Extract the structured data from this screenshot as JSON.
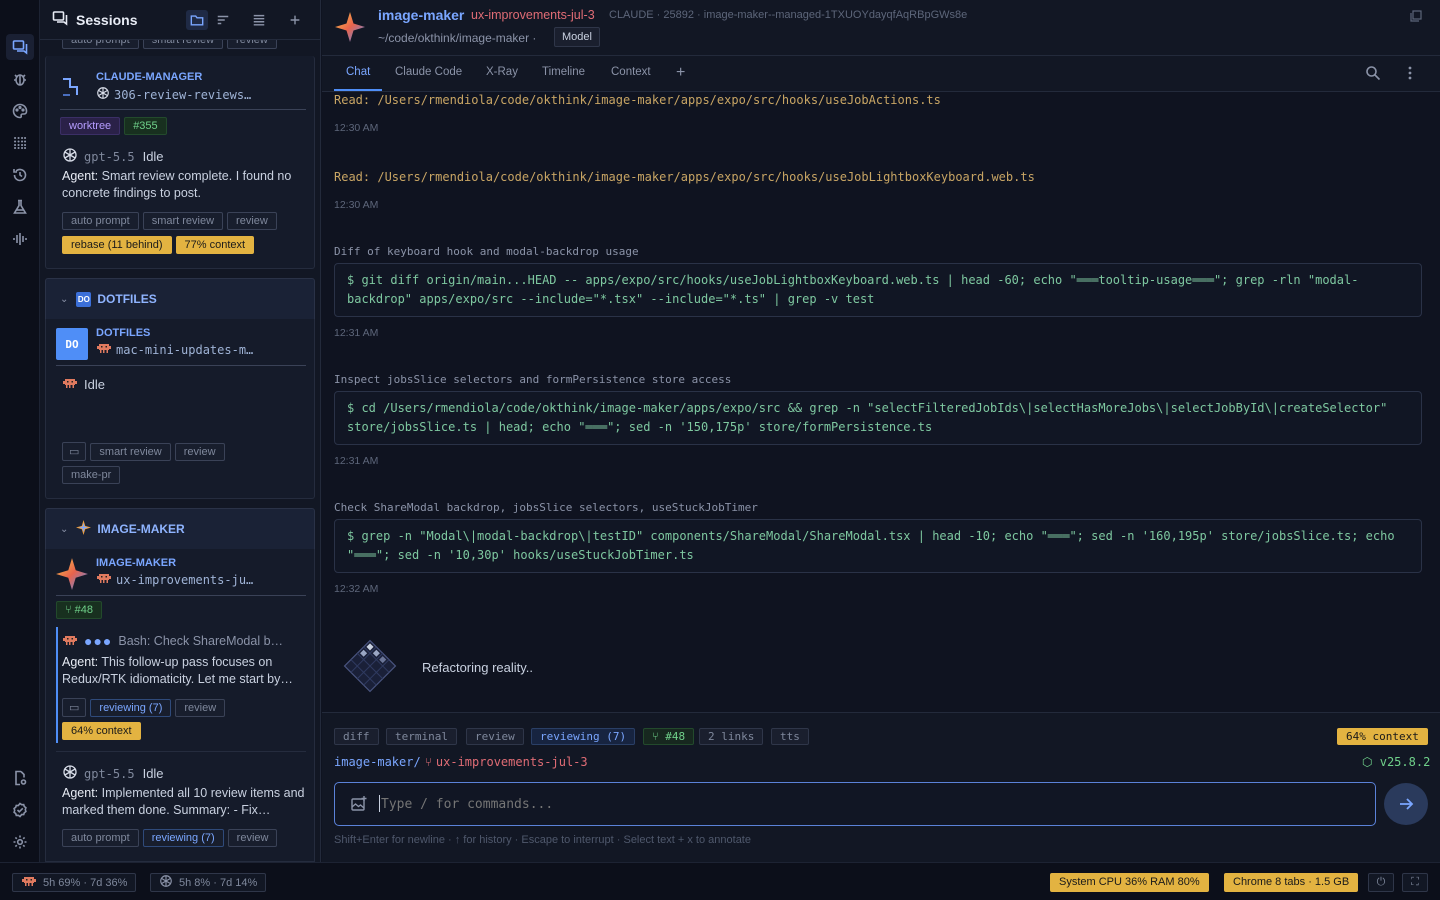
{
  "sessions_header": {
    "title": "Sessions"
  },
  "cards": {
    "top_partial_tags": [
      "auto prompt",
      "smart review",
      "review"
    ],
    "claude_manager": {
      "repo": "CLAUDE-MANAGER",
      "branch": "306-review-reviews…",
      "tags": [
        "worktree",
        "#355"
      ],
      "model": "gpt-5.5",
      "status": "Idle",
      "agent_prefix": "Agent:",
      "agent_text": "Smart review complete. I found no concrete findings to post.",
      "chips": [
        "auto prompt",
        "smart review",
        "review"
      ],
      "warn": [
        "rebase (11 behind)",
        "77% context"
      ]
    },
    "dotfiles_group": {
      "name": "DOTFILES",
      "badge": "DO"
    },
    "dotfiles": {
      "repo": "DOTFILES",
      "avatar": "DO",
      "branch": "mac-mini-updates-m…",
      "status": "Idle",
      "chips": [
        "smart review",
        "review",
        "make-pr"
      ]
    },
    "imagemaker_group": {
      "name": "IMAGE-MAKER"
    },
    "imagemaker": {
      "repo": "IMAGE-MAKER",
      "branch": "ux-improvements-ju…",
      "pr": "#48",
      "activity": "Bash: Check ShareModal b…",
      "agent_prefix": "Agent:",
      "agent_text": "This follow-up pass focuses on Redux/RTK idiomaticity. Let me start by…",
      "chips": [
        "reviewing (7)",
        "review"
      ],
      "warn": "64% context",
      "sub_model": "gpt-5.5",
      "sub_status": "Idle",
      "sub_agent_prefix": "Agent:",
      "sub_agent_text": "Implemented all 10 review items and marked them done. Summary: - Fix…",
      "sub_chips": [
        "auto prompt",
        "reviewing (7)",
        "review"
      ]
    }
  },
  "top": {
    "project": "image-maker",
    "branch": "ux-improvements-jul-3",
    "meta": "CLAUDE · 25892 · image-maker--managed-1TXUOYdayqfAqRBpGWs8e",
    "path": "~/code/okthink/image-maker ·",
    "model_btn": "Model"
  },
  "tabs": [
    "Chat",
    "Claude Code",
    "X-Ray",
    "Timeline",
    "Context"
  ],
  "chat": {
    "read1": "Read: /Users/rmendiola/code/okthink/image-maker/apps/expo/src/hooks/useJobActions.ts",
    "time1": "12:30 AM",
    "read2": "Read: /Users/rmendiola/code/okthink/image-maker/apps/expo/src/hooks/useJobLightboxKeyboard.web.ts",
    "time2": "12:30 AM",
    "desc3": "Diff of keyboard hook and modal-backdrop usage",
    "cmd3a": "$ git diff origin/main...HEAD -- apps/expo/src/hooks/useJobLightboxKeyboard.web.ts | head -60; echo \"═══tooltip-usage═══\"; grep -rln \"modal-",
    "cmd3b": "backdrop\" apps/expo/src --include=\"*.tsx\" --include=\"*.ts\" | grep -v test",
    "time3": "12:31 AM",
    "desc4": "Inspect jobsSlice selectors and formPersistence store access",
    "cmd4a": "$ cd /Users/rmendiola/code/okthink/image-maker/apps/expo/src && grep -n \"selectFilteredJobIds\\|selectHasMoreJobs\\|selectJobById\\|createSelector\"",
    "cmd4b": "store/jobsSlice.ts | head; echo \"═══\"; sed -n '150,175p' store/formPersistence.ts",
    "time4": "12:31 AM",
    "desc5": "Check ShareModal backdrop, jobsSlice selectors, useStuckJobTimer",
    "cmd5a": "$ grep -n \"Modal\\|modal-backdrop\\|testID\" components/ShareModal/ShareModal.tsx | head -10; echo \"═══\"; sed -n '160,195p' store/jobsSlice.ts; echo",
    "cmd5b": "\"═══\"; sed -n '10,30p' hooks/useStuckJobTimer.ts",
    "time5": "12:32 AM",
    "thinking": "Refactoring reality.."
  },
  "compose": {
    "tags": [
      "diff",
      "terminal",
      "review",
      "reviewing (7)",
      "#48",
      "2 links",
      "tts"
    ],
    "context": "64% context",
    "path_prefix": "image-maker/",
    "branch": "ux-improvements-jul-3",
    "version": "v25.8.2",
    "placeholder": "Type / for commands...",
    "hint": "Shift+Enter for newline · ↑ for history · Escape to interrupt · Select text + x to annotate"
  },
  "statusbar": {
    "claude": "5h 69% · 7d 36%",
    "gpt": "5h 8% · 7d 14%",
    "sys": "System CPU 36% RAM 80%",
    "chrome": "Chrome 8 tabs · 1.5 GB"
  }
}
